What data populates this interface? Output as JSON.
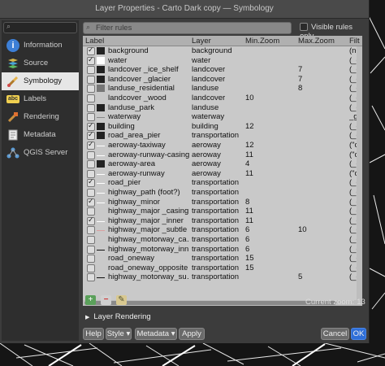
{
  "window": {
    "title": "Layer Properties - Carto Dark copy — Symbology"
  },
  "sidebar": {
    "items": [
      {
        "label": "Information",
        "icon": "info-icon",
        "active": false
      },
      {
        "label": "Source",
        "icon": "source-icon",
        "active": false
      },
      {
        "label": "Symbology",
        "icon": "paintbrush-icon",
        "active": true
      },
      {
        "label": "Labels",
        "icon": "labels-icon",
        "active": false
      },
      {
        "label": "Rendering",
        "icon": "rendering-icon",
        "active": false
      },
      {
        "label": "Metadata",
        "icon": "metadata-icon",
        "active": false
      },
      {
        "label": "QGIS Server",
        "icon": "server-icon",
        "active": false
      }
    ]
  },
  "filter": {
    "placeholder": "Filter rules",
    "visible_only_label": "Visible rules only"
  },
  "table": {
    "headers": [
      "Label",
      "Layer",
      "Min.Zoom",
      "Max.Zoom",
      "Filt"
    ],
    "rows": [
      {
        "checked": true,
        "sym": "dark",
        "label": "background",
        "layer": "background",
        "min": "",
        "max": "",
        "filter": "(no"
      },
      {
        "checked": true,
        "sym": "white",
        "label": "water",
        "layer": "water",
        "min": "",
        "max": "",
        "filter": "(_g"
      },
      {
        "checked": false,
        "sym": "dark",
        "label": "landcover _ice_shelf",
        "layer": "landcover",
        "min": "",
        "max": "7",
        "filter": "(_g"
      },
      {
        "checked": false,
        "sym": "dark",
        "label": "landcover _glacier",
        "layer": "landcover",
        "min": "",
        "max": "7",
        "filter": "(_g"
      },
      {
        "checked": false,
        "sym": "gray",
        "label": "landuse_residential",
        "layer": "landuse",
        "min": "",
        "max": "8",
        "filter": "(_g"
      },
      {
        "checked": false,
        "sym": "none",
        "label": "landcover _wood",
        "layer": "landcover",
        "min": "10",
        "max": "",
        "filter": "(_g"
      },
      {
        "checked": false,
        "sym": "dark",
        "label": "landuse_park",
        "layer": "landuse",
        "min": "",
        "max": "",
        "filter": "(_g"
      },
      {
        "checked": false,
        "sym": "thinline",
        "label": "waterway",
        "layer": "waterway",
        "min": "",
        "max": "",
        "filter": "_ge"
      },
      {
        "checked": true,
        "sym": "dark",
        "label": "building",
        "layer": "building",
        "min": "12",
        "max": "",
        "filter": "(_g"
      },
      {
        "checked": true,
        "sym": "dark",
        "label": "road_area_pier",
        "layer": "transportation",
        "min": "",
        "max": "",
        "filter": "(_g"
      },
      {
        "checked": true,
        "sym": "line",
        "label": "aeroway-taxiway",
        "layer": "aeroway",
        "min": "12",
        "max": "",
        "filter": "(\"c"
      },
      {
        "checked": false,
        "sym": "line",
        "label": "aeroway-runway-casing",
        "layer": "aeroway",
        "min": "11",
        "max": "",
        "filter": "(\"c"
      },
      {
        "checked": false,
        "sym": "dark",
        "label": "aeroway-area",
        "layer": "aeroway",
        "min": "4",
        "max": "",
        "filter": "(_g"
      },
      {
        "checked": false,
        "sym": "line",
        "label": "aeroway-runway",
        "layer": "aeroway",
        "min": "11",
        "max": "",
        "filter": "(\"c"
      },
      {
        "checked": true,
        "sym": "line",
        "label": "road_pier",
        "layer": "transportation",
        "min": "",
        "max": "",
        "filter": "(_g"
      },
      {
        "checked": false,
        "sym": "line",
        "label": "highway_path (foot?)",
        "layer": "transportation",
        "min": "",
        "max": "",
        "filter": "(_g"
      },
      {
        "checked": true,
        "sym": "line",
        "label": "highway_minor",
        "layer": "transportation",
        "min": "8",
        "max": "",
        "filter": "(_g"
      },
      {
        "checked": false,
        "sym": "none",
        "label": "highway_major _casing",
        "layer": "transportation",
        "min": "11",
        "max": "",
        "filter": "(_g"
      },
      {
        "checked": true,
        "sym": "line",
        "label": "highway_major _inner",
        "layer": "transportation",
        "min": "11",
        "max": "",
        "filter": "(_g"
      },
      {
        "checked": false,
        "sym": "pinkline",
        "label": "highway_major _subtle",
        "layer": "transportation",
        "min": "6",
        "max": "10",
        "filter": "(_g"
      },
      {
        "checked": false,
        "sym": "none",
        "label": "highway_motorway_ca…",
        "layer": "transportation",
        "min": "6",
        "max": "",
        "filter": "(_g"
      },
      {
        "checked": false,
        "sym": "blackline",
        "label": "highway_motorway_inn…",
        "layer": "transportation",
        "min": "6",
        "max": "",
        "filter": "(_g"
      },
      {
        "checked": false,
        "sym": "none",
        "label": "road_oneway",
        "layer": "transportation",
        "min": "15",
        "max": "",
        "filter": "(_g"
      },
      {
        "checked": false,
        "sym": "none",
        "label": "road_oneway_opposite",
        "layer": "transportation",
        "min": "15",
        "max": "",
        "filter": "(_g"
      },
      {
        "checked": false,
        "sym": "blackline",
        "label": "highway_motorway_su…",
        "layer": "transportation",
        "min": "",
        "max": "5",
        "filter": "(_g"
      }
    ]
  },
  "toolbar": {
    "add_glyph": "+",
    "remove_glyph": "−",
    "edit_glyph": "✎"
  },
  "zoom": {
    "label": "Current zoom:",
    "value": "13"
  },
  "layer_rendering": {
    "label": "Layer Rendering"
  },
  "buttons": {
    "help": "Help",
    "style": "Style",
    "metadata": "Metadata",
    "apply": "Apply",
    "cancel": "Cancel",
    "ok": "OK"
  },
  "colors": {
    "window_bg": "#3c3c3c",
    "table_bg": "#c9c9c9",
    "active_nav_bg": "#e6e6e6",
    "add_green": "#4caf50",
    "remove_red": "#d9534f"
  }
}
